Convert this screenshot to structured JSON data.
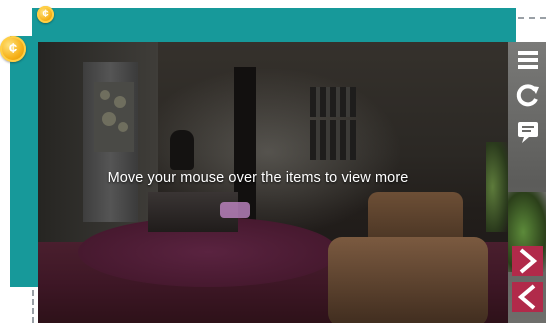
{
  "badges": {
    "small_coin_symbol": "¢",
    "large_coin_symbol": "¢"
  },
  "scene": {
    "instruction_text": "Move your mouse over the items to view more"
  },
  "sidebar": {
    "buttons": [
      {
        "name": "menu",
        "icon": "hamburger-icon"
      },
      {
        "name": "restart",
        "icon": "refresh-icon"
      },
      {
        "name": "comment",
        "icon": "comment-icon"
      },
      {
        "name": "next",
        "icon": "chevron-right-icon"
      },
      {
        "name": "previous",
        "icon": "chevron-left-icon"
      }
    ]
  },
  "colors": {
    "teal_frame": "#17999a",
    "nav_button": "#b12a4a",
    "coin": "#f6b017"
  }
}
